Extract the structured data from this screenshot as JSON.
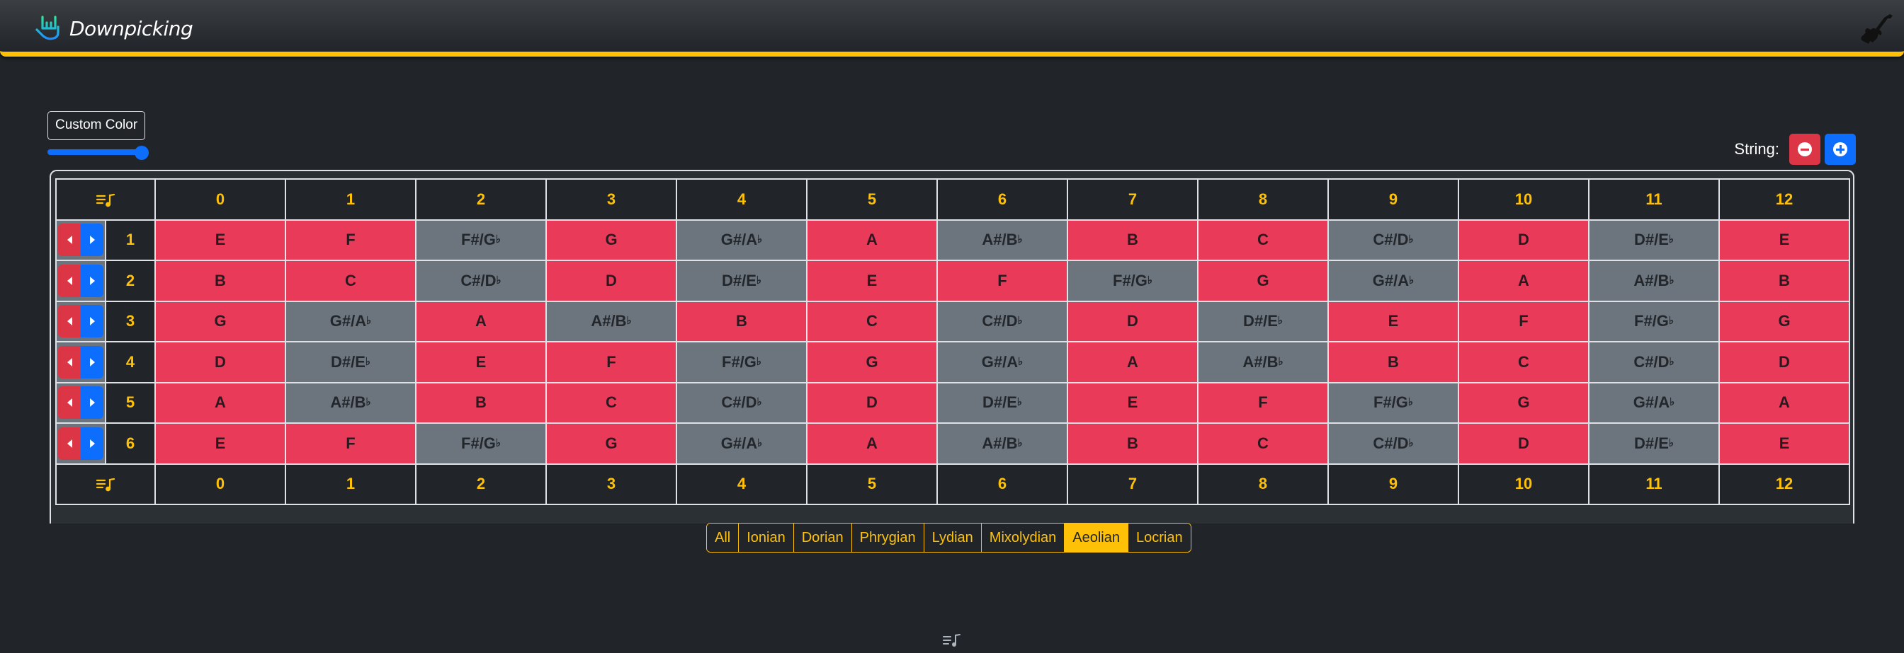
{
  "navbar": {
    "brand": "Downpicking",
    "logo_icon": "rock-hand-icon",
    "right_icon": "guitar-icon"
  },
  "controls": {
    "custom_color_label": "Custom Color",
    "slider_value_fraction": 1.0,
    "string_label": "String:",
    "remove_string_icon": "minus-circle-icon",
    "add_string_icon": "plus-circle-icon"
  },
  "colors": {
    "accent": "#ffc107",
    "in_scale": "#ea3a5a",
    "out_of_scale": "#6c757d",
    "background": "#212529",
    "primary": "#0d6efd",
    "danger": "#dc3545"
  },
  "fretboard": {
    "frets": [
      "0",
      "1",
      "2",
      "3",
      "4",
      "5",
      "6",
      "7",
      "8",
      "9",
      "10",
      "11",
      "12"
    ],
    "strings": [
      {
        "number": "1",
        "notes": [
          {
            "n": "E",
            "s": true
          },
          {
            "n": "F",
            "s": true
          },
          {
            "n": "F#/G♭",
            "s": false
          },
          {
            "n": "G",
            "s": true
          },
          {
            "n": "G#/A♭",
            "s": false
          },
          {
            "n": "A",
            "s": true
          },
          {
            "n": "A#/B♭",
            "s": false
          },
          {
            "n": "B",
            "s": true
          },
          {
            "n": "C",
            "s": true
          },
          {
            "n": "C#/D♭",
            "s": false
          },
          {
            "n": "D",
            "s": true
          },
          {
            "n": "D#/E♭",
            "s": false
          },
          {
            "n": "E",
            "s": true
          }
        ]
      },
      {
        "number": "2",
        "notes": [
          {
            "n": "B",
            "s": true
          },
          {
            "n": "C",
            "s": true
          },
          {
            "n": "C#/D♭",
            "s": false
          },
          {
            "n": "D",
            "s": true
          },
          {
            "n": "D#/E♭",
            "s": false
          },
          {
            "n": "E",
            "s": true
          },
          {
            "n": "F",
            "s": true
          },
          {
            "n": "F#/G♭",
            "s": false
          },
          {
            "n": "G",
            "s": true
          },
          {
            "n": "G#/A♭",
            "s": false
          },
          {
            "n": "A",
            "s": true
          },
          {
            "n": "A#/B♭",
            "s": false
          },
          {
            "n": "B",
            "s": true
          }
        ]
      },
      {
        "number": "3",
        "notes": [
          {
            "n": "G",
            "s": true
          },
          {
            "n": "G#/A♭",
            "s": false
          },
          {
            "n": "A",
            "s": true
          },
          {
            "n": "A#/B♭",
            "s": false
          },
          {
            "n": "B",
            "s": true
          },
          {
            "n": "C",
            "s": true
          },
          {
            "n": "C#/D♭",
            "s": false
          },
          {
            "n": "D",
            "s": true
          },
          {
            "n": "D#/E♭",
            "s": false
          },
          {
            "n": "E",
            "s": true
          },
          {
            "n": "F",
            "s": true
          },
          {
            "n": "F#/G♭",
            "s": false
          },
          {
            "n": "G",
            "s": true
          }
        ]
      },
      {
        "number": "4",
        "notes": [
          {
            "n": "D",
            "s": true
          },
          {
            "n": "D#/E♭",
            "s": false
          },
          {
            "n": "E",
            "s": true
          },
          {
            "n": "F",
            "s": true
          },
          {
            "n": "F#/G♭",
            "s": false
          },
          {
            "n": "G",
            "s": true
          },
          {
            "n": "G#/A♭",
            "s": false
          },
          {
            "n": "A",
            "s": true
          },
          {
            "n": "A#/B♭",
            "s": false
          },
          {
            "n": "B",
            "s": true
          },
          {
            "n": "C",
            "s": true
          },
          {
            "n": "C#/D♭",
            "s": false
          },
          {
            "n": "D",
            "s": true
          }
        ]
      },
      {
        "number": "5",
        "notes": [
          {
            "n": "A",
            "s": true
          },
          {
            "n": "A#/B♭",
            "s": false
          },
          {
            "n": "B",
            "s": true
          },
          {
            "n": "C",
            "s": true
          },
          {
            "n": "C#/D♭",
            "s": false
          },
          {
            "n": "D",
            "s": true
          },
          {
            "n": "D#/E♭",
            "s": false
          },
          {
            "n": "E",
            "s": true
          },
          {
            "n": "F",
            "s": true
          },
          {
            "n": "F#/G♭",
            "s": false
          },
          {
            "n": "G",
            "s": true
          },
          {
            "n": "G#/A♭",
            "s": false
          },
          {
            "n": "A",
            "s": true
          }
        ]
      },
      {
        "number": "6",
        "notes": [
          {
            "n": "E",
            "s": true
          },
          {
            "n": "F",
            "s": true
          },
          {
            "n": "F#/G♭",
            "s": false
          },
          {
            "n": "G",
            "s": true
          },
          {
            "n": "G#/A♭",
            "s": false
          },
          {
            "n": "A",
            "s": true
          },
          {
            "n": "A#/B♭",
            "s": false
          },
          {
            "n": "B",
            "s": true
          },
          {
            "n": "C",
            "s": true
          },
          {
            "n": "C#/D♭",
            "s": false
          },
          {
            "n": "D",
            "s": true
          },
          {
            "n": "D#/E♭",
            "s": false
          },
          {
            "n": "E",
            "s": true
          }
        ]
      }
    ]
  },
  "modes": {
    "items": [
      "All",
      "Ionian",
      "Dorian",
      "Phrygian",
      "Lydian",
      "Mixolydian",
      "Aeolian",
      "Locrian"
    ],
    "active": "Aeolian"
  },
  "footer": {
    "icon": "music-note-list-icon"
  }
}
